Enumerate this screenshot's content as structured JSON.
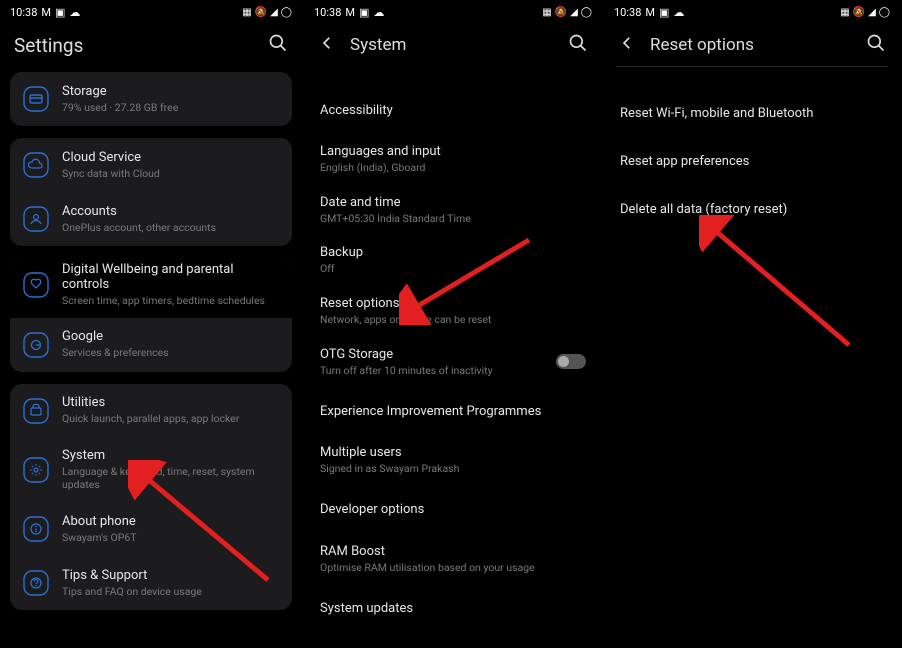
{
  "status": {
    "time": "10:38",
    "left_icons": [
      "M",
      "▣",
      "☁"
    ],
    "right_icons": [
      "▦",
      "🔕",
      "◢",
      "◯"
    ]
  },
  "panel1": {
    "title": "Settings",
    "groups": [
      {
        "items": [
          {
            "icon": "storage",
            "title": "Storage",
            "sub": "79% used · 27.28 GB free"
          }
        ]
      },
      {
        "items": [
          {
            "icon": "cloud",
            "title": "Cloud Service",
            "sub": "Sync data with Cloud"
          },
          {
            "icon": "accounts",
            "title": "Accounts",
            "sub": "OnePlus account, other accounts"
          }
        ]
      },
      {
        "items": [
          {
            "icon": "wellbeing",
            "title": "Digital Wellbeing and parental controls",
            "sub": "Screen time, app timers, bedtime schedules"
          },
          {
            "icon": "google",
            "title": "Google",
            "sub": "Services & preferences"
          }
        ]
      },
      {
        "items": [
          {
            "icon": "utilities",
            "title": "Utilities",
            "sub": "Quick launch, parallel apps, app locker"
          },
          {
            "icon": "system",
            "title": "System",
            "sub": "Language & keyboard, time, reset, system updates"
          },
          {
            "icon": "about",
            "title": "About phone",
            "sub": "Swayam's OP6T"
          },
          {
            "icon": "tips",
            "title": "Tips & Support",
            "sub": "Tips and FAQ on device usage"
          }
        ]
      }
    ]
  },
  "panel2": {
    "title": "System",
    "items": [
      {
        "title": "Accessibility",
        "sub": ""
      },
      {
        "title": "Languages and input",
        "sub": "English (India), Gboard"
      },
      {
        "title": "Date and time",
        "sub": "GMT+05:30 India Standard Time"
      },
      {
        "title": "Backup",
        "sub": "Off"
      },
      {
        "title": "Reset options",
        "sub": "Network, apps or device can be reset"
      },
      {
        "title": "OTG Storage",
        "sub": "Turn off after 10 minutes of inactivity",
        "toggle": true
      },
      {
        "title": "Experience Improvement Programmes",
        "sub": ""
      },
      {
        "title": "Multiple users",
        "sub": "Signed in as Swayam Prakash"
      },
      {
        "title": "Developer options",
        "sub": ""
      },
      {
        "title": "RAM Boost",
        "sub": "Optimise RAM utilisation based on your usage"
      },
      {
        "title": "System updates",
        "sub": ""
      }
    ]
  },
  "panel3": {
    "title": "Reset options",
    "items": [
      {
        "title": "Reset Wi-Fi, mobile and Bluetooth"
      },
      {
        "title": "Reset app preferences"
      },
      {
        "title": "Delete all data (factory reset)"
      }
    ]
  }
}
